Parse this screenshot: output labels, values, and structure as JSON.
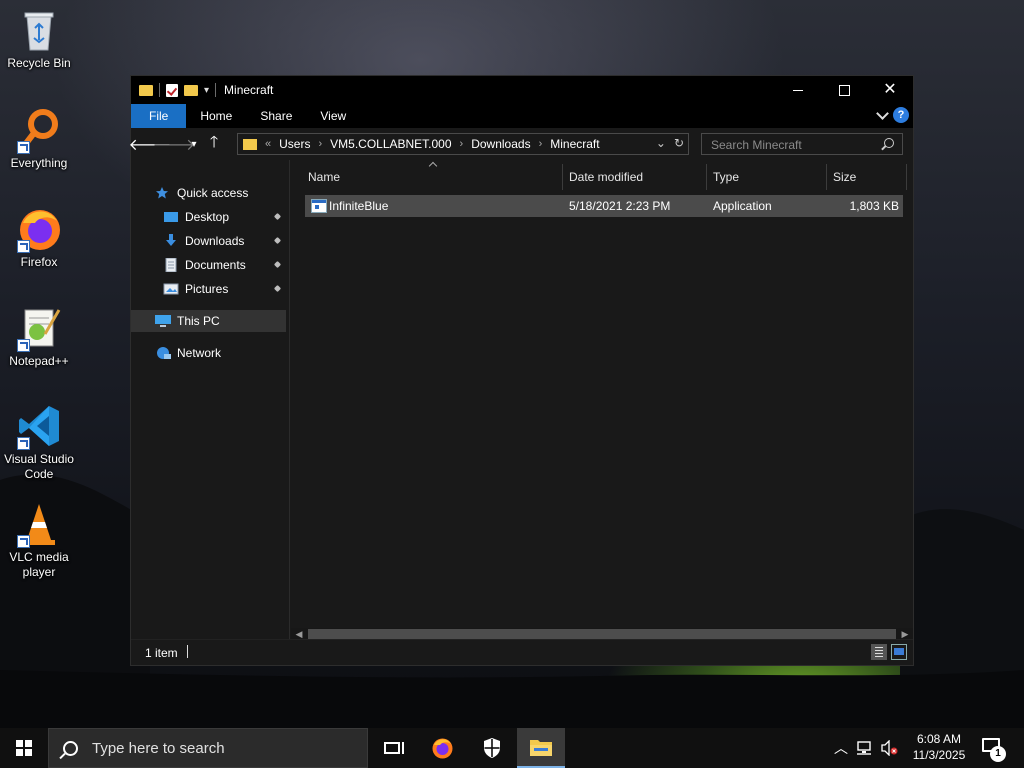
{
  "desktop": {
    "icons": [
      {
        "label": "Recycle Bin"
      },
      {
        "label": "Everything"
      },
      {
        "label": "Firefox"
      },
      {
        "label": "Notepad++"
      },
      {
        "label_line1": "Visual Studio",
        "label_line2": "Code"
      },
      {
        "label_line1": "VLC media",
        "label_line2": "player"
      }
    ]
  },
  "explorer": {
    "title": "Minecraft",
    "ribbon_tabs": {
      "file": "File",
      "home": "Home",
      "share": "Share",
      "view": "View"
    },
    "help_label": "?",
    "breadcrumb": {
      "overflow": "«",
      "items": [
        "Users",
        "VM5.COLLABNET.000",
        "Downloads",
        "Minecraft"
      ]
    },
    "search_placeholder": "Search Minecraft",
    "nav": {
      "quick_access": "Quick access",
      "desktop": "Desktop",
      "downloads": "Downloads",
      "documents": "Documents",
      "pictures": "Pictures",
      "this_pc": "This PC",
      "network": "Network"
    },
    "columns": {
      "name": "Name",
      "date": "Date modified",
      "type": "Type",
      "size": "Size"
    },
    "files": [
      {
        "name": "InfiniteBlue",
        "date": "5/18/2021 2:23 PM",
        "type": "Application",
        "size": "1,803 KB"
      }
    ],
    "status": {
      "item_count": "1 item"
    }
  },
  "taskbar": {
    "search_placeholder": "Type here to search",
    "time": "6:08 AM",
    "date": "11/3/2025",
    "notification_count": "1"
  },
  "colors": {
    "accent": "#1a6fc4",
    "selection": "#4b4b4b",
    "window_bg": "#191919",
    "titlebar_bg": "#000000"
  }
}
